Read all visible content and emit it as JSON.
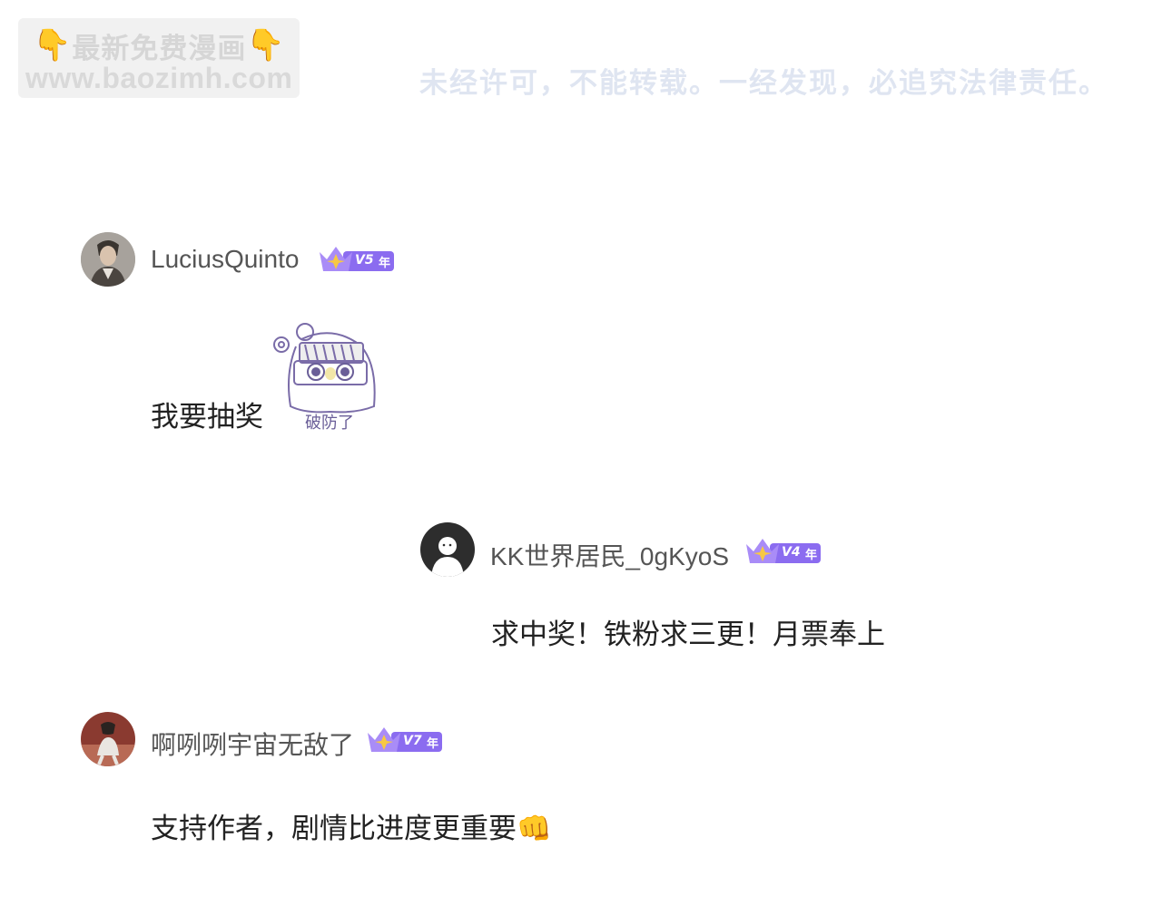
{
  "watermark": {
    "line1_prefix": "👇",
    "line1_text": "最新免费漫画",
    "line1_suffix": "👇",
    "line2": "www.baozimh.com"
  },
  "notice": "未经许可，不能转载。一经发现，必追究法律责任。",
  "comments": [
    {
      "username": "LuciusQuinto",
      "level": "V5",
      "badge_suffix": "年",
      "text": "我要抽奖",
      "sticker_caption": "破防了"
    },
    {
      "username": "KK世界居民_0gKyoS",
      "level": "V4",
      "badge_suffix": "年",
      "text": "求中奖！铁粉求三更！月票奉上"
    },
    {
      "username": "啊咧咧宇宙无敌了",
      "level": "V7",
      "badge_suffix": "年",
      "text": "支持作者，剧情比进度更重要",
      "emoji": "👊"
    }
  ],
  "colors": {
    "badge_purple": "#8b6cf0",
    "badge_star": "#f7c843",
    "username": "#555555",
    "comment": "#222222"
  }
}
